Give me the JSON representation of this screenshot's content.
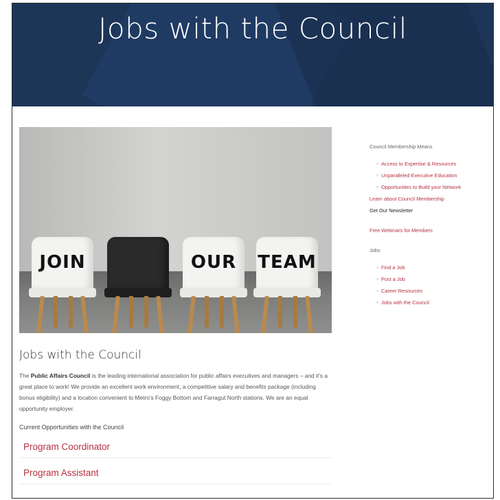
{
  "banner": {
    "title": "Jobs with the Council"
  },
  "hero": {
    "words": [
      "JOIN",
      "OUR",
      "TEAM"
    ]
  },
  "article": {
    "title": "Jobs with the Council",
    "org_name": "Public Affairs Council",
    "body_rest": "is the leading international association for public affairs executives and managers – and it's a great place to work! We provide an excellent work environment, a competitive salary and benefits package (including bonus eligibility) and a location convenient to Metro's Foggy Bottom and Farragut North stations. We are an equal opportunity employer.",
    "current_label": "Current Opportunities with the Council",
    "jobs": [
      "Program Coordinator",
      "Program Assistant"
    ]
  },
  "sidebar": {
    "membership_heading": "Council Membership Means",
    "membership_items": [
      "Access to Expertise & Resources",
      "Unparalleled Executive Education",
      "Opportunities to Build your Network"
    ],
    "learn_link": "Learn about Council Membership",
    "newsletter_link": "Get Our Newsletter",
    "webinars_link": "Free Webinars for Members",
    "jobs_heading": "Jobs",
    "jobs_items": [
      "Find a Job",
      "Post a Job",
      "Career Resources",
      "Jobs with the Council"
    ]
  },
  "colors": {
    "banner": "#1d3557",
    "accent": "#b8313f"
  }
}
